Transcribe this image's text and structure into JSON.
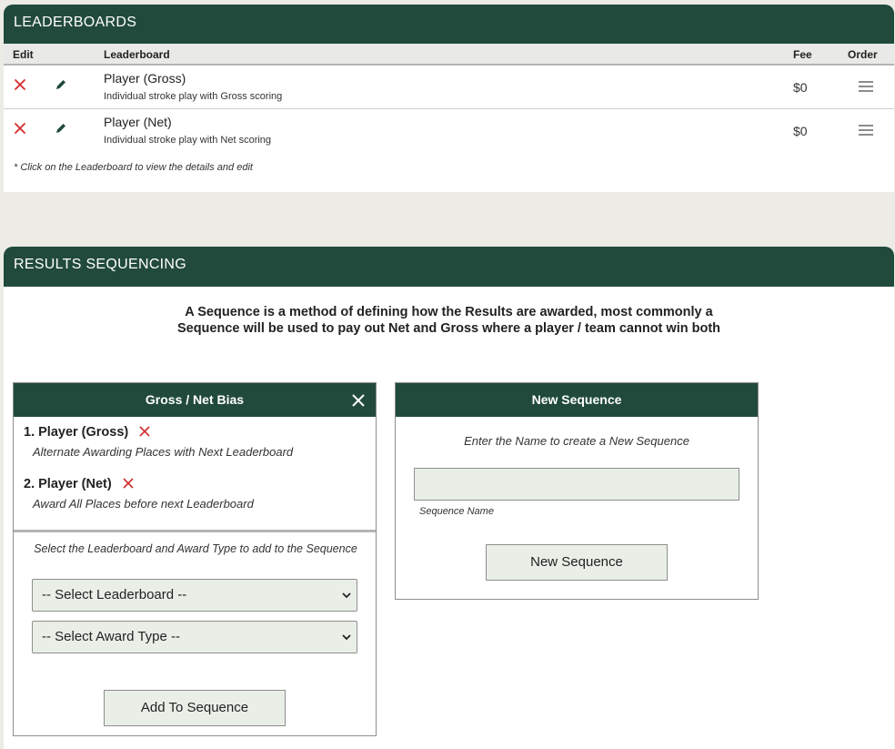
{
  "leaderboards": {
    "title": "LEADERBOARDS",
    "columns": {
      "edit": "Edit",
      "leaderboard": "Leaderboard",
      "fee": "Fee",
      "order": "Order"
    },
    "rows": [
      {
        "name": "Player (Gross)",
        "description": "Individual stroke play with Gross scoring",
        "fee": "$0"
      },
      {
        "name": "Player (Net)",
        "description": "Individual stroke play with Net scoring",
        "fee": "$0"
      }
    ],
    "note": "* Click on the Leaderboard to view the details and edit"
  },
  "results": {
    "title": "RESULTS SEQUENCING",
    "intro_line1": "A Sequence is a method of defining how the Results are awarded, most commonly a",
    "intro_line2": "Sequence will be used to pay out Net and Gross where a player / team cannot win both",
    "sequence_card": {
      "title": "Gross / Net Bias",
      "items": [
        {
          "title": "1. Player (Gross)",
          "subtitle": "Alternate Awarding Places with Next Leaderboard"
        },
        {
          "title": "2. Player (Net)",
          "subtitle": "Award All Places before next Leaderboard"
        }
      ],
      "select_note": "Select the Leaderboard and Award Type to add to the Sequence",
      "select_leaderboard": "-- Select Leaderboard --",
      "select_award_type": "-- Select Award Type --",
      "add_button": "Add To Sequence"
    },
    "new_card": {
      "title": "New Sequence",
      "note": "Enter the Name to create a New Sequence",
      "input_value": "",
      "input_label": "Sequence Name",
      "button": "New Sequence"
    }
  },
  "colors": {
    "header": "#214a3d",
    "accent_red": "#d12b2b",
    "field_bg": "#e9efe7"
  },
  "icons": {
    "delete": "x-icon",
    "edit": "pencil-icon",
    "order": "hamburger-icon",
    "close": "close-icon",
    "dropdown": "chevron-down-icon"
  }
}
